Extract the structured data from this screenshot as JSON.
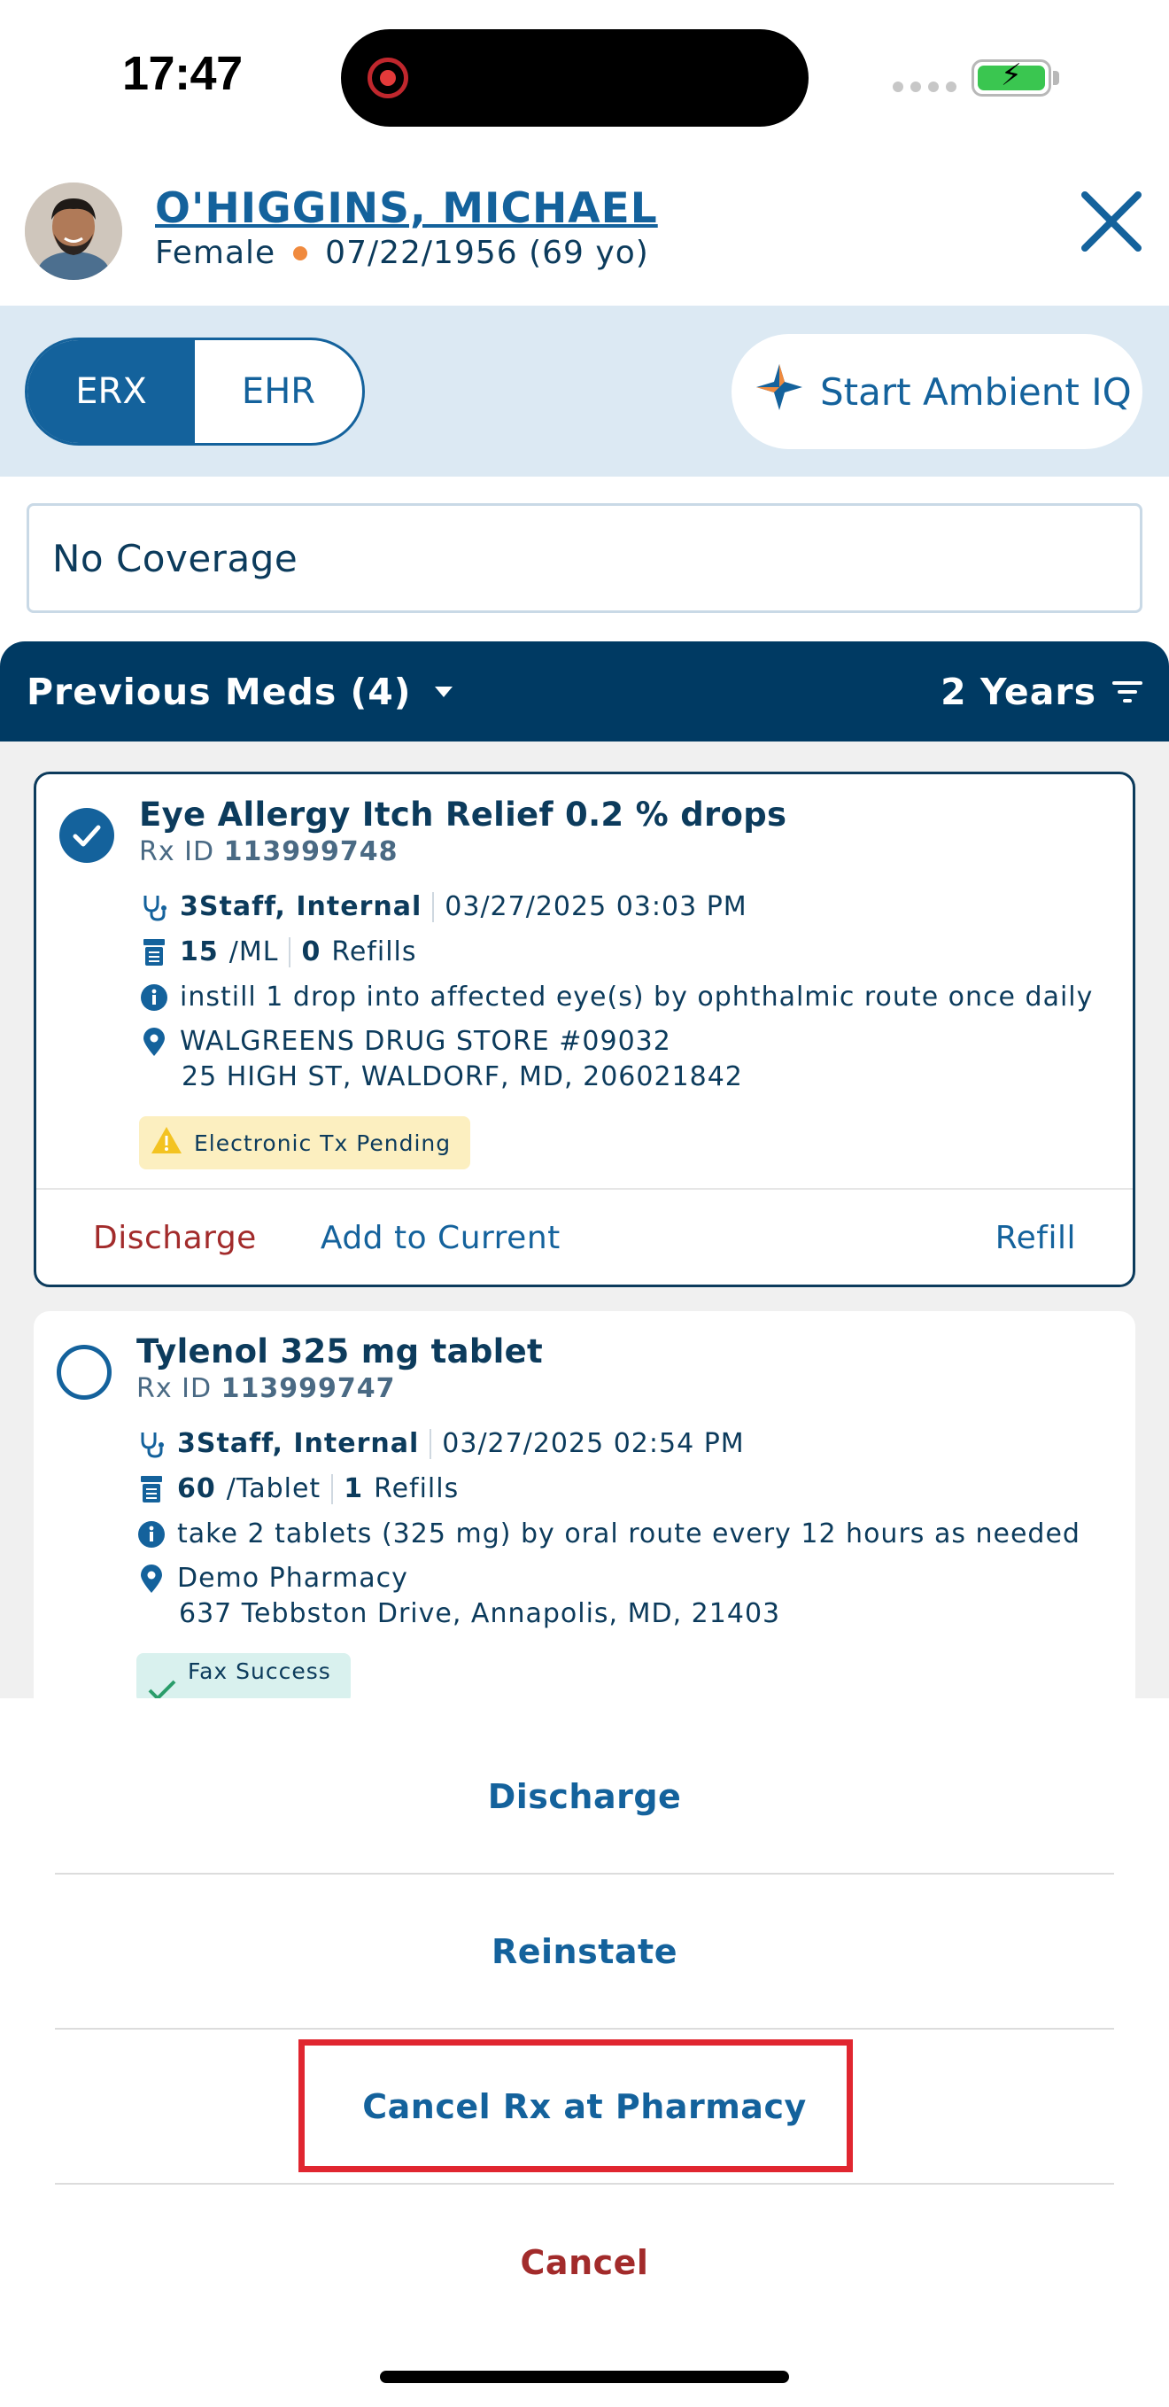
{
  "status_bar": {
    "time": "17:47"
  },
  "patient": {
    "name": "O'HIGGINS, MICHAEL",
    "sex": "Female",
    "dob": "07/22/1956 (69 yo)"
  },
  "mode_toggle": {
    "options": [
      "ERX",
      "EHR"
    ],
    "selected": "ERX"
  },
  "ambient_button": {
    "label": "Start Ambient IQ"
  },
  "coverage": {
    "label": "No Coverage"
  },
  "meds_header": {
    "title": "Previous Meds (4)",
    "range": "2 Years"
  },
  "meds": [
    {
      "name": "Eye Allergy Itch Relief 0.2 % drops",
      "rx_label": "Rx ID",
      "rx_id": "113999748",
      "prescriber": "3Staff, Internal",
      "datetime": "03/27/2025 03:03 PM",
      "quantity": "15",
      "unit": "/ML",
      "refills_count": "0",
      "refills_label": "Refills",
      "instructions": "instill 1 drop into affected eye(s) by ophthalmic route once daily",
      "pharmacy": "WALGREENS DRUG STORE #09032",
      "address": "25 HIGH ST, WALDORF, MD, 206021842",
      "status": "Electronic Tx Pending",
      "selected": true,
      "actions": {
        "discharge": "Discharge",
        "add": "Add to Current",
        "refill": "Refill"
      }
    },
    {
      "name": "Tylenol 325 mg tablet",
      "rx_label": "Rx ID",
      "rx_id": "113999747",
      "prescriber": "3Staff, Internal",
      "datetime": "03/27/2025 02:54 PM",
      "quantity": "60",
      "unit": "/Tablet",
      "refills_count": "1",
      "refills_label": "Refills",
      "instructions": "take 2 tablets (325 mg) by oral route every 12 hours as needed",
      "pharmacy": "Demo Pharmacy",
      "address": "637 Tebbston Drive, Annapolis, MD, 21403",
      "status": "Fax Success",
      "selected": false
    }
  ],
  "action_sheet": {
    "items": [
      "Discharge",
      "Reinstate",
      "Cancel Rx at Pharmacy"
    ],
    "cancel": "Cancel"
  },
  "colors": {
    "primary": "#14629c",
    "navy": "#003a63",
    "danger": "#a22b2b",
    "highlight": "#e02630",
    "band": "#dce9f3"
  }
}
